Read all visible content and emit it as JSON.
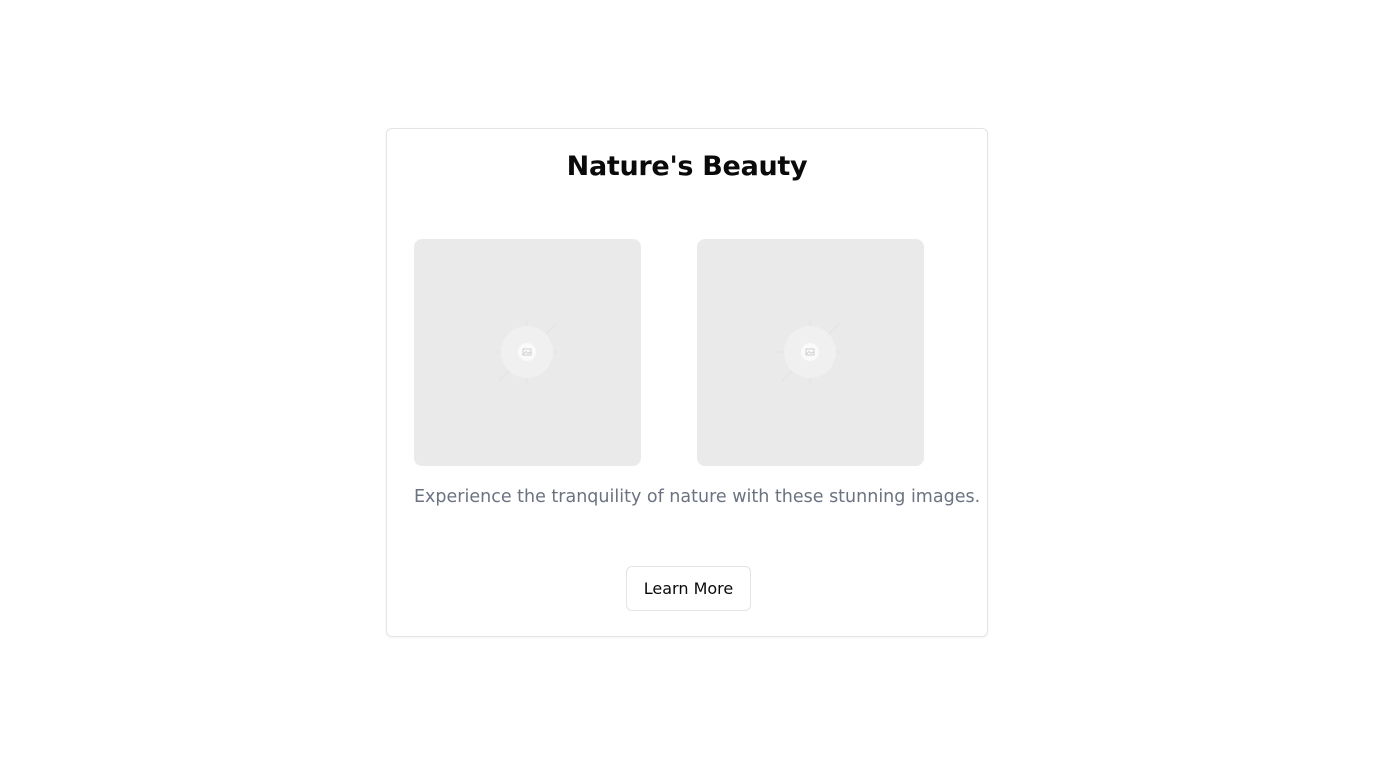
{
  "card": {
    "title": "Nature's Beauty",
    "description": "Experience the tranquility of nature with these stunning images.",
    "button_label": "Learn More"
  },
  "images": [
    {
      "icon": "image-placeholder-icon"
    },
    {
      "icon": "image-placeholder-icon"
    }
  ],
  "colors": {
    "card_border": "#e4e4e7",
    "placeholder_bg": "#eaeaea",
    "description_text": "#6b7280",
    "title_text": "#0a0a0a"
  }
}
